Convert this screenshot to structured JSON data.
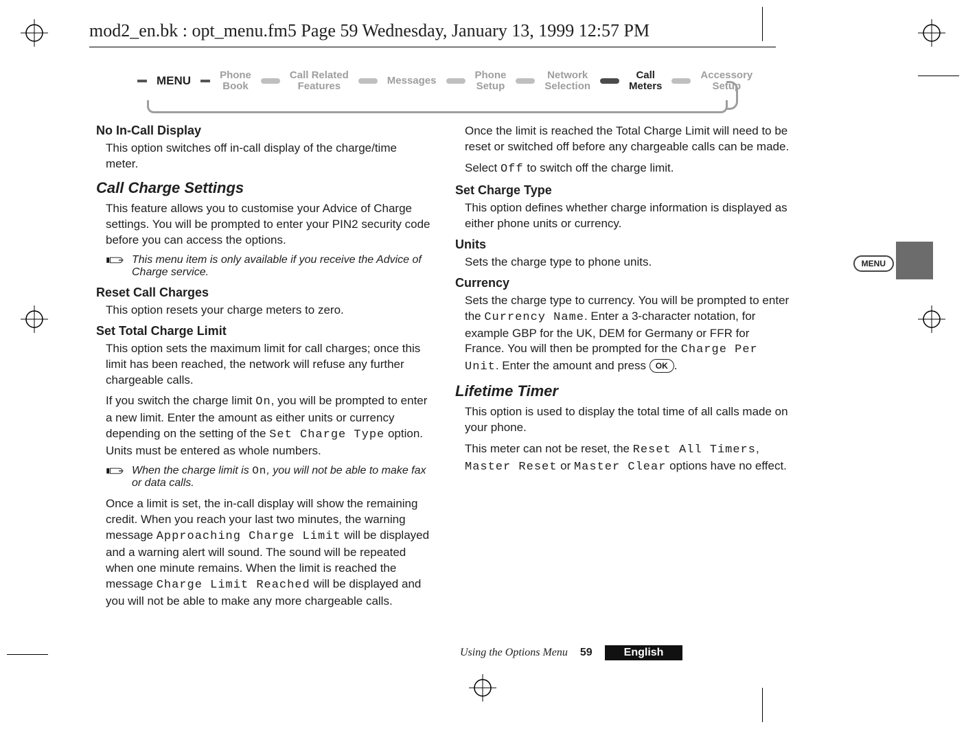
{
  "header": {
    "running_head": "mod2_en.bk : opt_menu.fm5  Page 59  Wednesday, January 13, 1999  12:57 PM"
  },
  "breadcrumb": {
    "menu_label": "MENU",
    "items": [
      {
        "line1": "Phone",
        "line2": "Book",
        "active": false
      },
      {
        "line1": "Call Related",
        "line2": "Features",
        "active": false
      },
      {
        "line1": "Messages",
        "line2": "",
        "active": false
      },
      {
        "line1": "Phone",
        "line2": "Setup",
        "active": false
      },
      {
        "line1": "Network",
        "line2": "Selection",
        "active": false
      },
      {
        "line1": "Call",
        "line2": "Meters",
        "active": true
      },
      {
        "line1": "Accessory",
        "line2": "Setup",
        "active": false
      }
    ]
  },
  "left": {
    "h_no_in_call": "No In-Call Display",
    "p_no_in_call": "This option switches off in-call display of the charge/time meter.",
    "h_call_charge_settings": "Call Charge Settings",
    "p_ccs_1": "This feature allows you to customise your Advice of Charge settings. You will be prompted to enter your PIN2 security code before you can access the options.",
    "note_ccs": "This menu item is only available if you receive the Advice of Charge service.",
    "h_reset": "Reset Call Charges",
    "p_reset": "This option resets your charge meters to zero.",
    "h_set_limit": "Set Total Charge Limit",
    "p_set_limit_1": "This option sets the maximum limit for call charges; once this limit has been reached, the network will refuse any further chargeable calls.",
    "p_set_limit_2a": "If you switch the charge limit ",
    "lcd_on_1": "On",
    "p_set_limit_2b": ", you will be prompted to enter a new limit. Enter the amount as either units or currency depending on the setting of the ",
    "lcd_sct": "Set Charge Type",
    "p_set_limit_2c": " option. Units must be entered as whole numbers.",
    "note_limit_a": "When the charge limit is ",
    "lcd_on_2": "On",
    "note_limit_b": ", you will not be able to make fax or data calls.",
    "p_set_limit_3a": "Once a limit is set, the in-call display will show the remaining credit. When you reach your last two minutes, the warning message ",
    "lcd_approaching": "Approaching Charge Limit",
    "p_set_limit_3b": " will be displayed and a warning alert will sound. The sound will be repeated when one minute remains. When the limit is reached the message ",
    "lcd_reached": "Charge Limit Reached",
    "p_set_limit_3c": " will be displayed and you will not be able to make any more chargeable calls."
  },
  "right": {
    "p_top": "Once the limit is reached the Total Charge Limit will need to be reset or switched off before any chargeable calls can be made.",
    "p_select_off_a": "Select ",
    "lcd_off": "Off",
    "p_select_off_b": " to switch off the charge limit.",
    "h_set_charge_type": "Set Charge Type",
    "p_sct": "This option defines whether charge information is displayed as either phone units or currency.",
    "h_units": "Units",
    "p_units": "Sets the charge type to phone units.",
    "h_currency": "Currency",
    "p_currency_a": "Sets the charge type to currency. You will be prompted to enter the ",
    "lcd_currency_name": "Currency Name",
    "p_currency_b": ". Enter a 3-character notation, for example GBP for the UK, DEM for Germany or FFR for France. You will then be prompted for the ",
    "lcd_cpu": "Charge Per Unit",
    "p_currency_c": ". Enter the amount and press ",
    "ok_label": "OK",
    "p_currency_d": ".",
    "h_lifetime": "Lifetime Timer",
    "p_lifetime_1": "This option is used to display the total time of all calls made on your phone.",
    "p_lifetime_2a": "This meter can not be reset, the ",
    "lcd_reset_all": "Reset All Timers",
    "sep1": ", ",
    "lcd_master_reset": "Master Reset",
    "sep2": " or ",
    "lcd_master_clear": "Master Clear",
    "p_lifetime_2b": " options have no effect."
  },
  "side": {
    "menu_pill": "MENU"
  },
  "footer": {
    "breadcrumb": "Using the Options Menu",
    "page": "59",
    "language": "English"
  }
}
